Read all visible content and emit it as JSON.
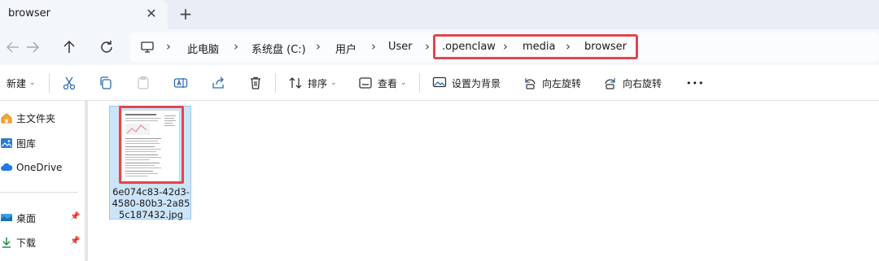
{
  "tab": {
    "title": "browser",
    "close_glyph": "✕",
    "new_tab_glyph": "+"
  },
  "nav": {
    "back_icon": "arrow-left-icon",
    "forward_icon": "arrow-right-icon",
    "up_icon": "arrow-up-icon",
    "refresh_icon": "refresh-icon"
  },
  "breadcrumb": {
    "items": [
      "此电脑",
      "系统盘 (C:)",
      "用户",
      "User",
      ".openclaw",
      "media",
      "browser"
    ],
    "separator": "›",
    "highlight_color": "#e0474c"
  },
  "toolbar": {
    "new_label": "新建",
    "sort_label": "排序",
    "view_label": "查看",
    "set_background_label": "设置为背景",
    "rotate_left_label": "向左旋转",
    "rotate_right_label": "向右旋转",
    "more_glyph": "•••"
  },
  "sidebar": {
    "items": [
      {
        "label": "主文件夹",
        "icon": "home-icon"
      },
      {
        "label": "图库",
        "icon": "gallery-icon"
      },
      {
        "label": "OneDrive",
        "icon": "cloud-icon"
      },
      {
        "label": "桌面",
        "icon": "desktop-icon"
      },
      {
        "label": "下载",
        "icon": "download-icon"
      }
    ]
  },
  "files": [
    {
      "name": "6e074c83-42d3-4580-80b3-2a855c187432.jpg",
      "selected": true
    }
  ]
}
